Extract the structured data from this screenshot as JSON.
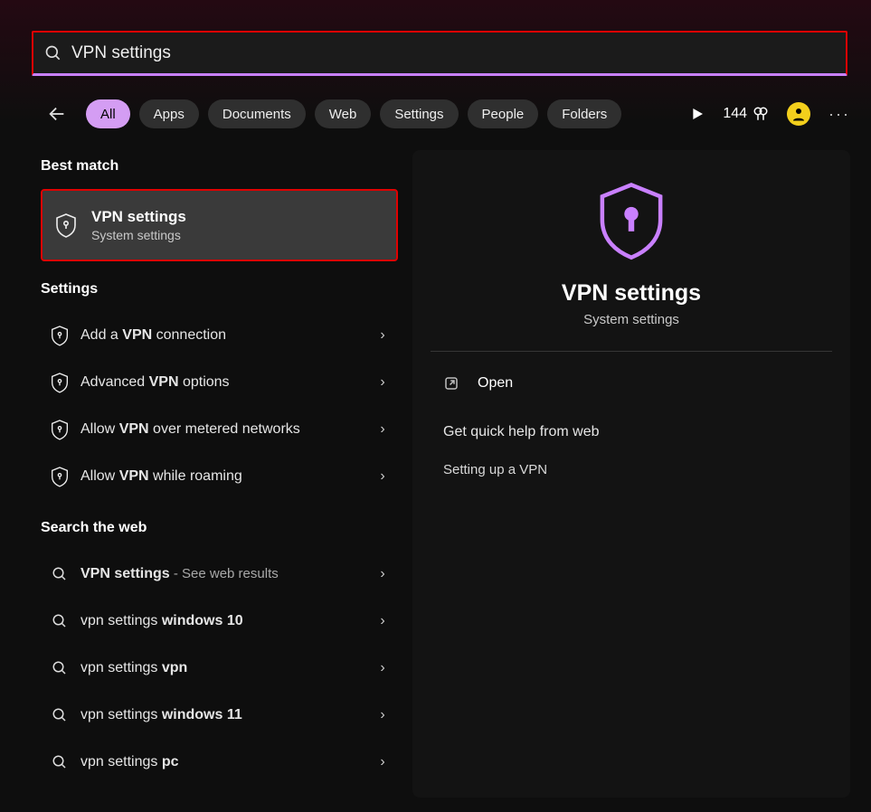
{
  "search": {
    "query": "VPN settings"
  },
  "filters": {
    "items": [
      {
        "label": "All",
        "active": true
      },
      {
        "label": "Apps",
        "active": false
      },
      {
        "label": "Documents",
        "active": false
      },
      {
        "label": "Web",
        "active": false
      },
      {
        "label": "Settings",
        "active": false
      },
      {
        "label": "People",
        "active": false
      },
      {
        "label": "Folders",
        "active": false
      }
    ]
  },
  "rewards": {
    "count": "144"
  },
  "left": {
    "best_match_label": "Best match",
    "best_match": {
      "title": "VPN settings",
      "subtitle": "System settings"
    },
    "settings_label": "Settings",
    "settings_items": [
      {
        "pre": "Add a ",
        "bold": "VPN",
        "post": " connection"
      },
      {
        "pre": "Advanced ",
        "bold": "VPN",
        "post": " options"
      },
      {
        "pre": "Allow ",
        "bold": "VPN",
        "post": " over metered networks"
      },
      {
        "pre": "Allow ",
        "bold": "VPN",
        "post": " while roaming"
      }
    ],
    "web_label": "Search the web",
    "web_items": [
      {
        "pre": "",
        "bold": "VPN settings",
        "post": "",
        "suffix": " - See web results"
      },
      {
        "pre": "vpn settings ",
        "bold": "windows 10",
        "post": "",
        "suffix": ""
      },
      {
        "pre": "vpn settings ",
        "bold": "vpn",
        "post": "",
        "suffix": ""
      },
      {
        "pre": "vpn settings ",
        "bold": "windows 11",
        "post": "",
        "suffix": ""
      },
      {
        "pre": "vpn settings ",
        "bold": "pc",
        "post": "",
        "suffix": ""
      }
    ]
  },
  "right": {
    "title": "VPN settings",
    "subtitle": "System settings",
    "open_label": "Open",
    "help_header": "Get quick help from web",
    "help_link": "Setting up a VPN"
  }
}
